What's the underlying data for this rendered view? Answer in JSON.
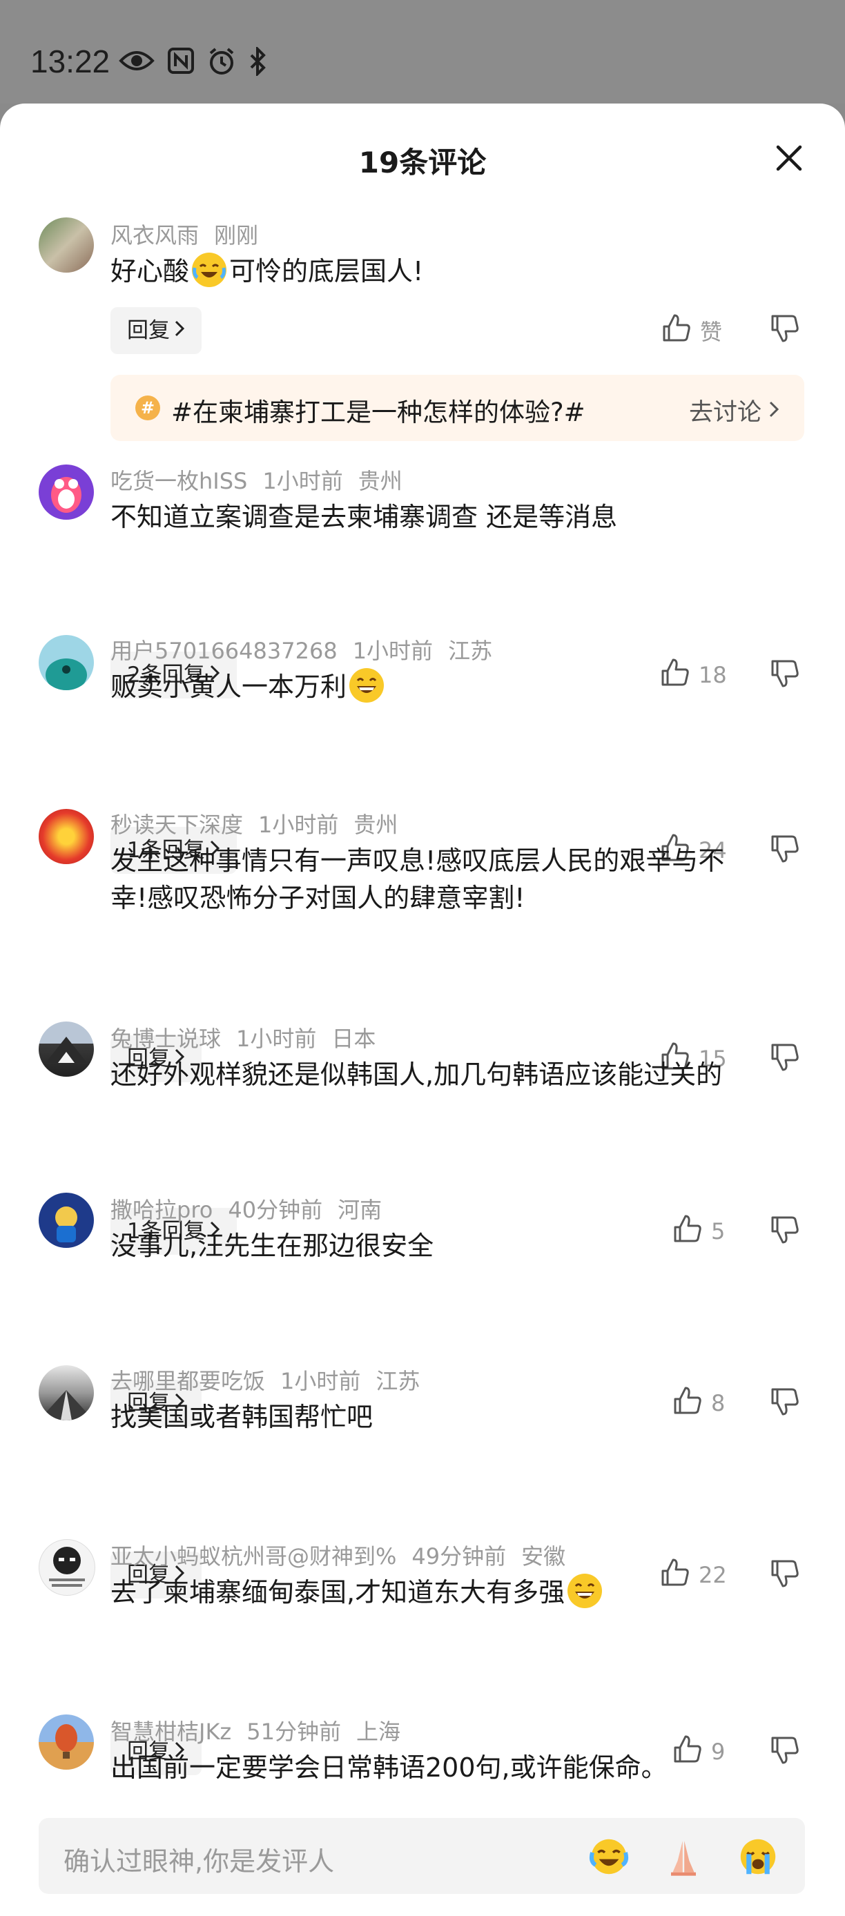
{
  "status_bar": {
    "time": "13:22",
    "icons": [
      "eye-icon",
      "nfc-icon",
      "alarm-icon",
      "bluetooth-icon"
    ]
  },
  "sheet": {
    "title": "19条评论",
    "close_icon": "close-icon"
  },
  "comments": [
    {
      "user": "风衣风雨",
      "time": "刚刚",
      "location": "",
      "text_before": "好心酸",
      "emoji": "crying-laughing-emoji",
      "text_after": "可怜的底层国人!",
      "reply_label": "回复",
      "likes": "赞"
    },
    {
      "user": "吃货一枚hISS",
      "time": "1小时前",
      "location": "贵州",
      "text": "不知道立案调查是去柬埔寨调查 还是等消息",
      "reply_label": "2条回复",
      "likes": "18"
    },
    {
      "user": "用户5701664837268",
      "time": "1小时前",
      "location": "江苏",
      "text_before": "贩卖小黄人一本万利",
      "emoji": "grinning-emoji",
      "reply_label": "1条回复",
      "likes": "24"
    },
    {
      "user": "秒读天下深度",
      "time": "1小时前",
      "location": "贵州",
      "text_line1": "发生这种事情只有一声叹息!感叹底层人民的艰辛与不",
      "text_line2": "幸!感叹恐怖分子对国人的肆意宰割!",
      "reply_label": "回复",
      "likes": "15"
    },
    {
      "user": "兔博士说球",
      "time": "1小时前",
      "location": "日本",
      "text": "还好外观样貌还是似韩国人,加几句韩语应该能过关的",
      "reply_label": "1条回复",
      "likes": "5"
    },
    {
      "user": "撒哈拉pro",
      "time": "40分钟前",
      "location": "河南",
      "text": "没事儿,汪先生在那边很安全",
      "reply_label": "回复",
      "likes": "8"
    },
    {
      "user": "去哪里都要吃饭",
      "time": "1小时前",
      "location": "江苏",
      "text": "找美国或者韩国帮忙吧",
      "reply_label": "回复",
      "likes": "22"
    },
    {
      "user": "亚太小蚂蚁杭州哥@财神到%",
      "time": "49分钟前",
      "location": "安徽",
      "text_before": "去了柬埔寨缅甸泰国,才知道东大有多强",
      "emoji": "grinning-emoji",
      "reply_label": "回复",
      "likes": "9"
    },
    {
      "user": "智慧柑桔JKz",
      "time": "51分钟前",
      "location": "上海",
      "text": "出国前一定要学会日常韩语200句,或许能保命。"
    }
  ],
  "topic": {
    "icon": "hashtag-icon",
    "text": "#在柬埔寨打工是一种怎样的体验?#",
    "link": "去讨论"
  },
  "input_bar": {
    "placeholder": "确认过眼神,你是发评人",
    "quick_emojis": [
      "crying-laughing-emoji",
      "praying-hands-emoji",
      "sobbing-emoji"
    ]
  }
}
